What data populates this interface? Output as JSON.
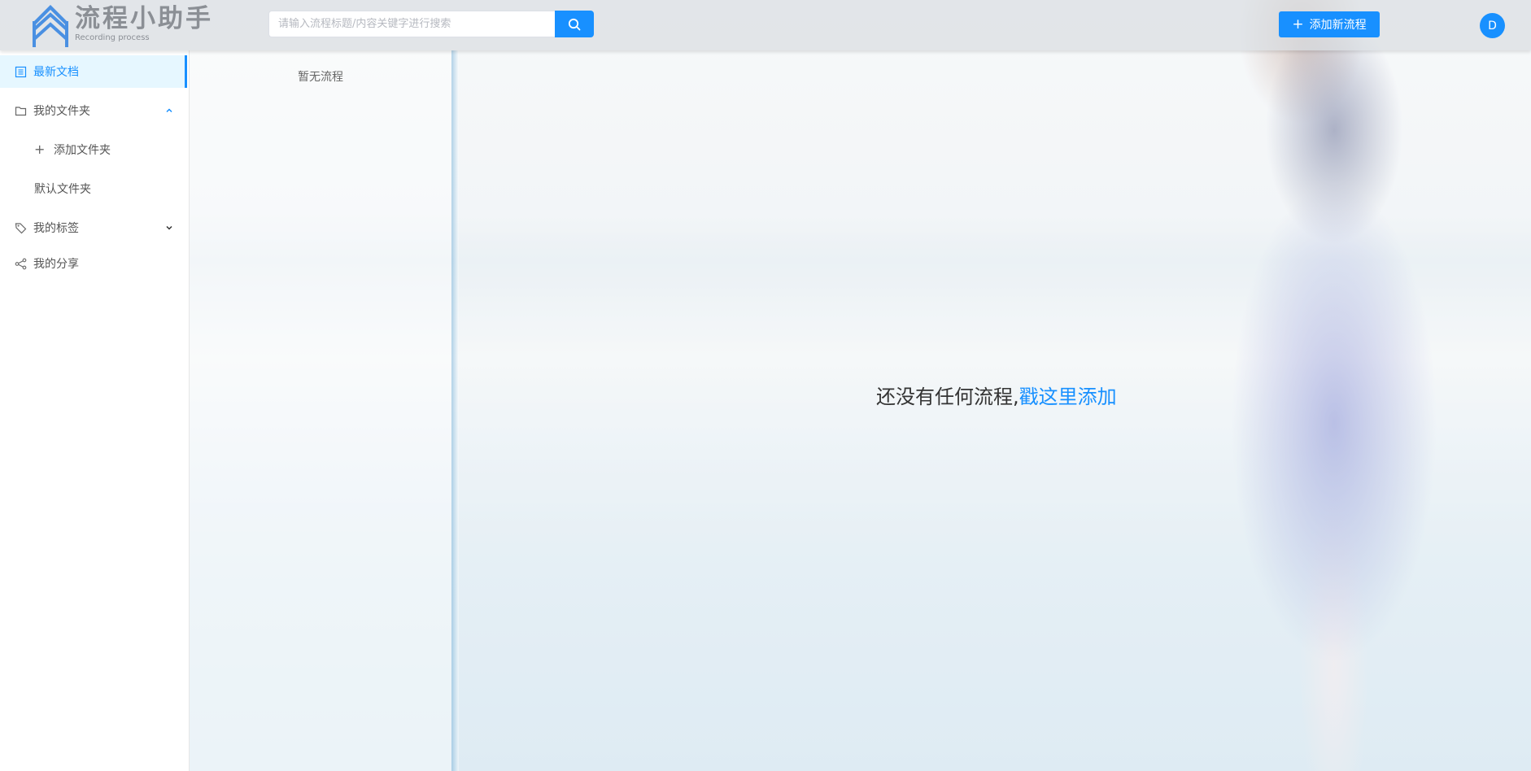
{
  "header": {
    "logo_title": "流程小助手",
    "logo_subtitle": "Recording process",
    "search_placeholder": "请输入流程标题/内容关键字进行搜索",
    "add_button_label": "添加新流程",
    "avatar_initial": "D"
  },
  "sidebar": {
    "items": [
      {
        "label": "最新文档",
        "icon": "document-icon",
        "active": true
      },
      {
        "label": "我的文件夹",
        "icon": "folder-icon",
        "expanded": true
      },
      {
        "label": "添加文件夹",
        "icon": "plus-icon"
      },
      {
        "label": "默认文件夹"
      },
      {
        "label": "我的标签",
        "icon": "tag-icon",
        "expanded": false
      },
      {
        "label": "我的分享",
        "icon": "share-icon"
      }
    ]
  },
  "list": {
    "empty_text": "暂无流程"
  },
  "main": {
    "empty_text": "还没有任何流程,",
    "empty_link": "戳这里添加"
  },
  "colors": {
    "accent": "#1890ff",
    "active_bg": "#e6f7ff"
  }
}
